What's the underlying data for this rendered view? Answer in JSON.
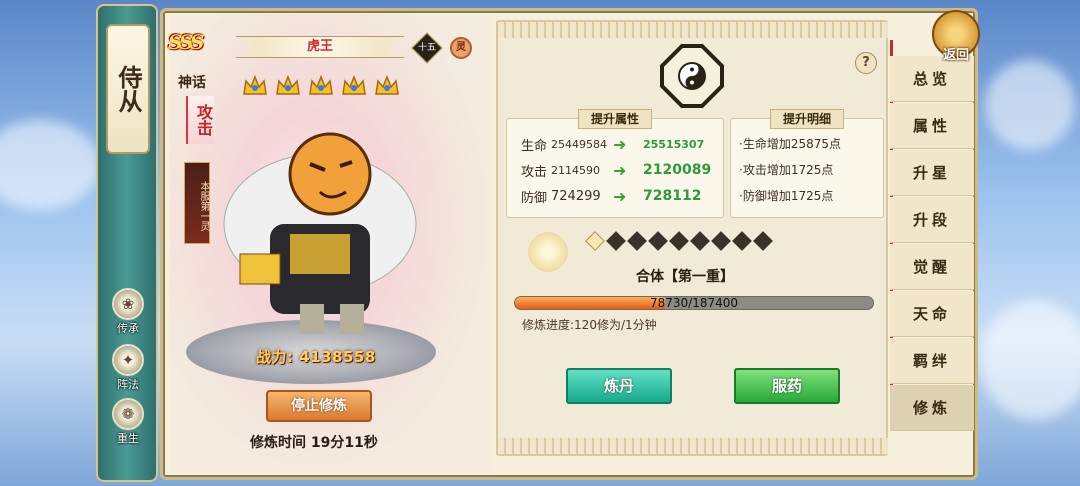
{
  "left_scroll": {
    "title": "侍从",
    "buttons": [
      {
        "label": "传承",
        "icon": "lotus-icon"
      },
      {
        "label": "阵法",
        "icon": "formation-icon"
      },
      {
        "label": "重生",
        "icon": "rebirth-icon"
      }
    ]
  },
  "hero": {
    "grade": "SSS",
    "tier": "神话",
    "name": "虎王",
    "level": "十五",
    "element": "灵",
    "stars": 5,
    "role": "攻击",
    "rank_banner": "本服第一灵",
    "power": "战力: 4138558",
    "stop_button": "停止修炼",
    "train_time": "修炼时间 19分11秒"
  },
  "stats": {
    "title": "提升属性",
    "rows": [
      {
        "name": "生命",
        "before": "25449584",
        "after": "25515307"
      },
      {
        "name": "攻击",
        "before": "2114590",
        "after": "2120089"
      },
      {
        "name": "防御",
        "before": "724299",
        "after": "728112"
      }
    ]
  },
  "details": {
    "title": "提升明细",
    "rows": [
      "·生命增加25875点",
      "·攻击增加1725点",
      "·防御增加1725点"
    ]
  },
  "progress": {
    "stage": "合体【第一重】",
    "current": 78730,
    "max": 187400,
    "label": "78730/187400",
    "fraction": 0.42,
    "rate": "修炼进度:120修为/1分钟",
    "lit_diamonds": 1,
    "total_diamonds": 9
  },
  "actions": {
    "pill": "炼丹",
    "medicine": "服药"
  },
  "tabs": [
    "总览",
    "属性",
    "升星",
    "升段",
    "觉醒",
    "天命",
    "羁绊",
    "修炼"
  ],
  "active_tab": "修炼",
  "back_label": "返回",
  "colors": {
    "panel": "#f5efdc",
    "accent_green": "#2f9a3c",
    "progress_fill": "#e25b15",
    "name_red": "#d22b2b"
  }
}
